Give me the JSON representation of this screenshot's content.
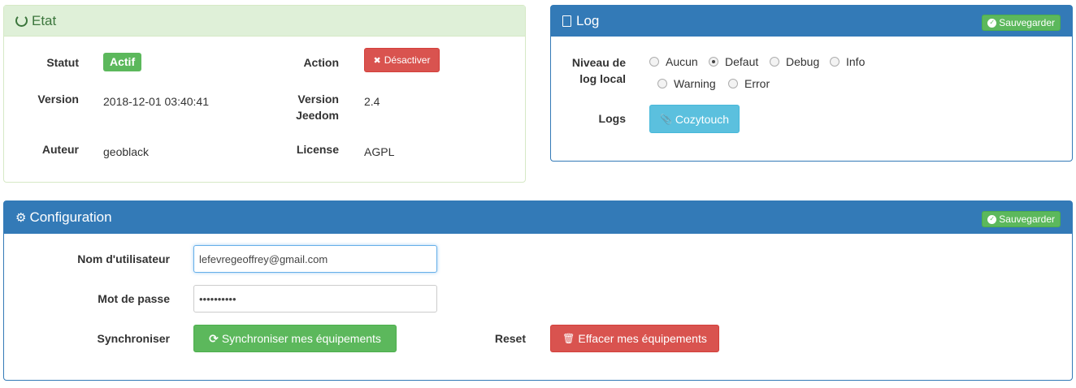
{
  "etat": {
    "title": "Etat",
    "statut_label": "Statut",
    "statut_value": "Actif",
    "action_label": "Action",
    "desactiver_label": "Désactiver",
    "version_label": "Version",
    "version_value": "2018-12-01 03:40:41",
    "version_jeedom_label_1": "Version",
    "version_jeedom_label_2": "Jeedom",
    "version_jeedom_value": "2.4",
    "auteur_label": "Auteur",
    "auteur_value": "geoblack",
    "license_label": "License",
    "license_value": "AGPL"
  },
  "log": {
    "title": "Log",
    "save_label": "Sauvegarder",
    "niveau_label_1": "Niveau de",
    "niveau_label_2": "log local",
    "levels": [
      "Aucun",
      "Defaut",
      "Debug",
      "Info",
      "Warning",
      "Error"
    ],
    "selected_level": "Defaut",
    "logs_label": "Logs",
    "cozytouch_label": "Cozytouch"
  },
  "configuration": {
    "title": "Configuration",
    "save_label": "Sauvegarder",
    "username_label": "Nom d'utilisateur",
    "username_value": "lefevregeoffrey@gmail.com",
    "password_label": "Mot de passe",
    "password_value": "password12",
    "sync_label": "Synchroniser",
    "sync_button": "Synchroniser mes équipements",
    "reset_label": "Reset",
    "reset_button": "Effacer mes équipements"
  },
  "colors": {
    "primary": "#337ab7",
    "success": "#5cb85c",
    "danger": "#d9534f",
    "info": "#5bc0de",
    "success_bg": "#dff0d8"
  }
}
